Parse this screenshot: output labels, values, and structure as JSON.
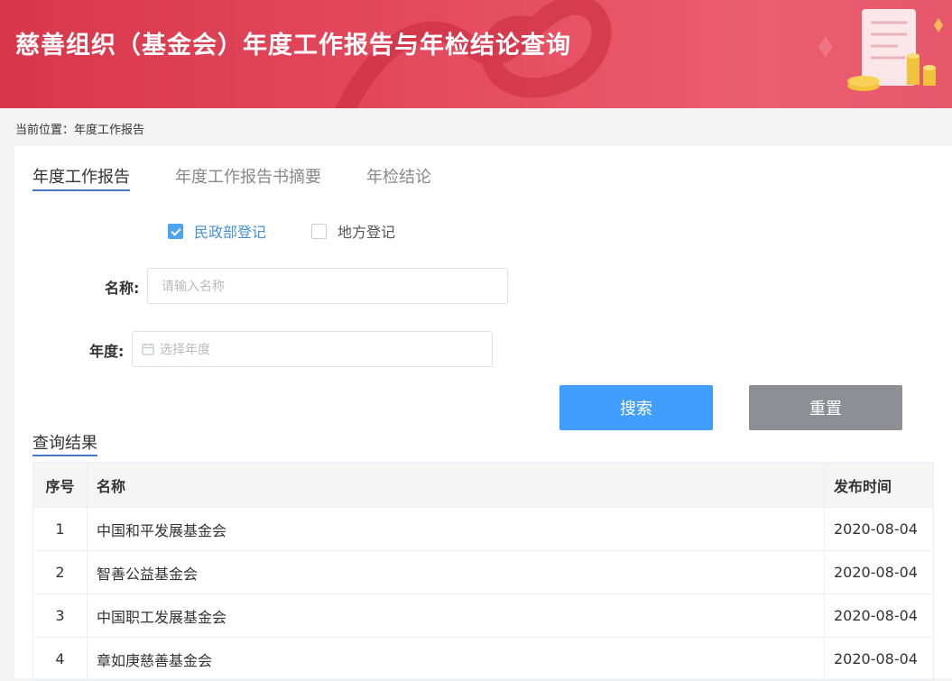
{
  "header": {
    "title": "慈善组织（基金会）年度工作报告与年检结论查询"
  },
  "breadcrumb": {
    "text": "当前位置：年度工作报告"
  },
  "tabs": [
    {
      "label": "年度工作报告",
      "active": true
    },
    {
      "label": "年度工作报告书摘要",
      "active": false
    },
    {
      "label": "年检结论",
      "active": false
    }
  ],
  "registration": [
    {
      "label": "民政部登记",
      "checked": true
    },
    {
      "label": "地方登记",
      "checked": false
    }
  ],
  "form": {
    "name_label": "名称:",
    "name_placeholder": "请输入名称",
    "name_value": "",
    "year_label": "年度:",
    "year_placeholder": "选择年度",
    "year_value": ""
  },
  "buttons": {
    "search": "搜索",
    "reset": "重置"
  },
  "results": {
    "title": "查询结果",
    "columns": [
      "序号",
      "名称",
      "发布时间"
    ],
    "rows": [
      [
        "1",
        "中国和平发展基金会",
        "2020-08-04"
      ],
      [
        "2",
        "智善公益基金会",
        "2020-08-04"
      ],
      [
        "3",
        "中国职工发展基金会",
        "2020-08-04"
      ],
      [
        "4",
        "章如庚慈善基金会",
        "2020-08-04"
      ]
    ]
  },
  "colors": {
    "banner": "#d8374b",
    "accent": "#409eff",
    "tab_underline": "#4a74c9",
    "reset": "#8c8f94"
  }
}
